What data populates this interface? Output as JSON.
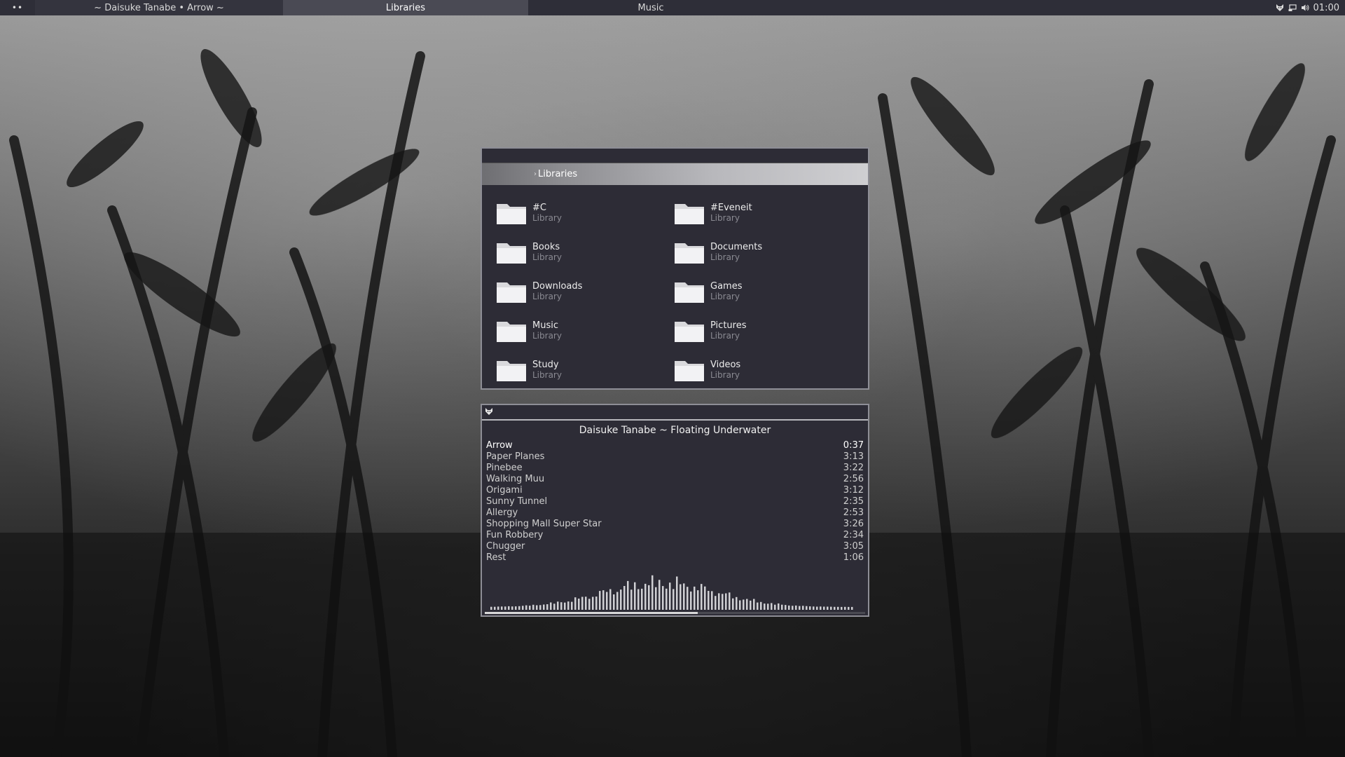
{
  "topbar": {
    "menu_dots": "••",
    "tabs": [
      {
        "label": "~ Daisuke Tanabe • Arrow  ~"
      },
      {
        "label": "Libraries"
      },
      {
        "label": "Music"
      }
    ],
    "clock": "01:00",
    "tray_icons": [
      "fox-icon",
      "network-icon",
      "volume-icon"
    ]
  },
  "libraries_window": {
    "header": "Libraries",
    "items": [
      {
        "name": "#C",
        "type": "Library"
      },
      {
        "name": "#Eveneit",
        "type": "Library"
      },
      {
        "name": "Books",
        "type": "Library"
      },
      {
        "name": "Documents",
        "type": "Library"
      },
      {
        "name": "Downloads",
        "type": "Library"
      },
      {
        "name": "Games",
        "type": "Library"
      },
      {
        "name": "Music",
        "type": "Library"
      },
      {
        "name": "Pictures",
        "type": "Library"
      },
      {
        "name": "Study",
        "type": "Library"
      },
      {
        "name": "Videos",
        "type": "Library"
      }
    ]
  },
  "music_window": {
    "app_icon": "fox-icon",
    "album": "Daisuke Tanabe ~ Floating Underwater",
    "current_track_index": 0,
    "progress": 0.56,
    "tracks": [
      {
        "title": "Arrow",
        "time": "0:37"
      },
      {
        "title": "Paper Planes",
        "time": "3:13"
      },
      {
        "title": "Pinebee",
        "time": "3:22"
      },
      {
        "title": "Walking Muu",
        "time": "2:56"
      },
      {
        "title": "Origami",
        "time": "3:12"
      },
      {
        "title": "Sunny Tunnel",
        "time": "2:35"
      },
      {
        "title": "Allergy",
        "time": "2:53"
      },
      {
        "title": "Shopping Mall Super Star",
        "time": "3:26"
      },
      {
        "title": "Fun Robbery",
        "time": "2:34"
      },
      {
        "title": "Chugger",
        "time": "3:05"
      },
      {
        "title": "Rest",
        "time": "1:06"
      }
    ]
  },
  "colors": {
    "bar_bg": "#2e2e38",
    "window_bg": "#2d2c36",
    "active_tab": "#4a4a54",
    "muted_text": "#8a8a92"
  }
}
